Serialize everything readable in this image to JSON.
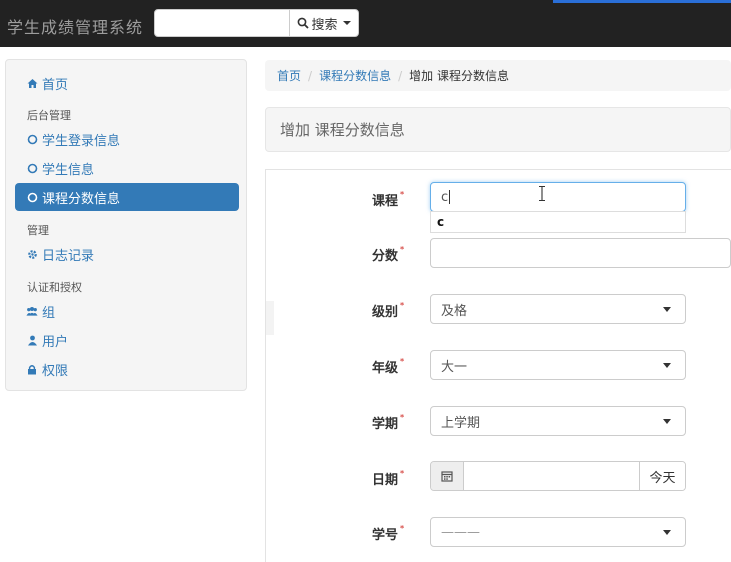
{
  "navbar": {
    "brand": "学生成绩管理系统",
    "search_value": "",
    "search_button": "搜索"
  },
  "sidebar": {
    "home": "首页",
    "section_admin": "后台管理",
    "admin_items": [
      "学生登录信息",
      "学生信息",
      "课程分数信息"
    ],
    "active_item": "课程分数信息",
    "section_manage": "管理",
    "log": "日志记录",
    "section_auth": "认证和授权",
    "auth_items": [
      "组",
      "用户",
      "权限"
    ]
  },
  "breadcrumb": [
    "首页",
    "课程分数信息",
    "增加 课程分数信息"
  ],
  "page_title": "增加 课程分数信息",
  "form": {
    "course": {
      "label": "课程",
      "value": "c",
      "suggestion": "c"
    },
    "score": {
      "label": "分数",
      "value": ""
    },
    "level": {
      "label": "级别",
      "value": "及格"
    },
    "grade": {
      "label": "年级",
      "value": "大一"
    },
    "term": {
      "label": "学期",
      "value": "上学期"
    },
    "date": {
      "label": "日期",
      "value": "",
      "today_button": "今天"
    },
    "student_no": {
      "label": "学号",
      "value": "———"
    }
  },
  "colors": {
    "navbar_bg": "#222222",
    "active_bg": "#337ab7",
    "link": "#337ab7",
    "required": "#d9534f"
  },
  "icons": [
    "search-icon",
    "home-icon",
    "circle-icon",
    "gear-icon",
    "users-icon",
    "user-icon",
    "lock-icon",
    "calendar-icon"
  ]
}
